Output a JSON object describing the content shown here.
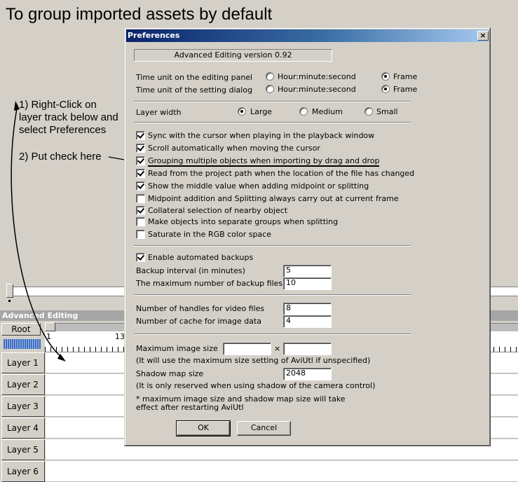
{
  "tutorial": {
    "title": "To group imported assets by default",
    "step1": [
      "1) Right-Click on",
      "layer track below and",
      "select Preferences"
    ],
    "step2": "2) Put check here"
  },
  "timeline": {
    "title": "Advanced Editing",
    "root_label": "Root",
    "ruler_ticks": [
      "1",
      "13"
    ],
    "layers": [
      "Layer  1",
      "Layer  2",
      "Layer  3",
      "Layer  4",
      "Layer  5",
      "Layer  6"
    ]
  },
  "dialog": {
    "title": "Preferences",
    "close_glyph": "×",
    "version": "Advanced Editing version 0.92",
    "time_unit_rows": [
      {
        "label": "Time unit on the editing panel",
        "options": [
          "Hour:minute:second",
          "Frame"
        ],
        "selected": "Frame"
      },
      {
        "label": "Time unit of the setting dialog",
        "options": [
          "Hour:minute:second",
          "Frame"
        ],
        "selected": "Frame"
      }
    ],
    "layer_width": {
      "label": "Layer width",
      "options": [
        "Large",
        "Medium",
        "Small"
      ],
      "selected": "Large"
    },
    "checkboxes": [
      {
        "label": "Sync with the cursor when playing in the playback window",
        "checked": true
      },
      {
        "label": "Scroll automatically when moving the cursor",
        "checked": true
      },
      {
        "label": "Grouping multiple objects when importing by drag and drop",
        "checked": true
      },
      {
        "label": "Read from the project path when the location of the file has changed",
        "checked": true
      },
      {
        "label": "Show the middle value when adding midpoint or splitting",
        "checked": true
      },
      {
        "label": "Midpoint addition and Splitting always carry out at current frame",
        "checked": false
      },
      {
        "label": "Collateral selection of nearby object",
        "checked": true
      },
      {
        "label": "Make objects into separate groups when splitting",
        "checked": false
      },
      {
        "label": "Saturate in the RGB color space",
        "checked": false
      }
    ],
    "backup": {
      "enable_label": "Enable automated backups",
      "enabled": true,
      "interval_label": "Backup interval (in minutes)",
      "interval_value": "5",
      "max_files_label": "The maximum number of backup files",
      "max_files_value": "10"
    },
    "handles": {
      "video_label": "Number of handles for video files",
      "video_value": "8",
      "cache_label": "Number of cache for image data",
      "cache_value": "4"
    },
    "image": {
      "max_size_label": "Maximum image size",
      "max_width_value": "",
      "max_height_value": "",
      "times_glyph": "×",
      "max_size_note": "(It will use the maximum size setting of AviUtl if unspecified)",
      "shadow_label": "Shadow map size",
      "shadow_value": "2048",
      "shadow_note": "(It is only reserved when using shadow of the camera control)",
      "restart_note": [
        "* maximum image size and shadow map size will take",
        "effect after restarting AviUtl"
      ]
    },
    "ok_label": "OK",
    "cancel_label": "Cancel"
  },
  "colors": {
    "titlebar_start": "#0a246a",
    "titlebar_end": "#a6caf0",
    "face": "#d4d0c8",
    "timeline_header": "#a6a6a6"
  }
}
